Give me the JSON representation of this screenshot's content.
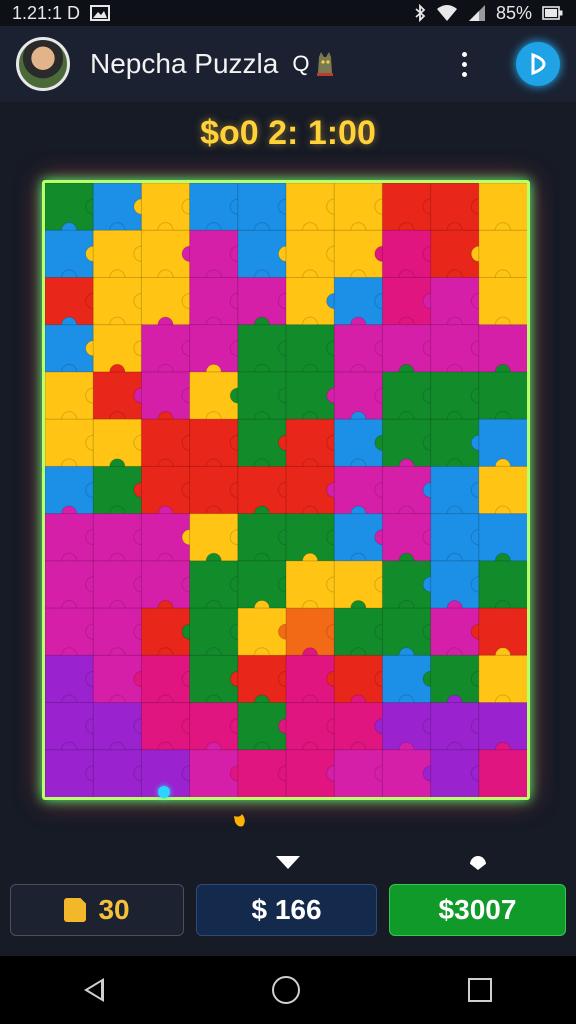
{
  "status_bar": {
    "time": "1.21:1 D",
    "battery": "85%",
    "icons": [
      "image-icon",
      "bluetooth-icon",
      "wifi-icon",
      "signal-icon",
      "battery-icon"
    ]
  },
  "app_bar": {
    "title": "Nepcha Puzzla",
    "title_glyph": "Q",
    "icons": [
      "avatar",
      "mascot-icon",
      "more-vert-icon",
      "brand-icon"
    ]
  },
  "timer": {
    "text": "$o0 2: 1:00"
  },
  "board": {
    "colors": {
      "Y": "#ffc414",
      "G": "#128c2b",
      "B": "#1c8fe6",
      "R": "#e82619",
      "M": "#d61fa9",
      "P": "#9a22cf",
      "K": "#e0157f",
      "O": "#f26a15"
    },
    "grid": [
      "GBYBBYYRRY",
      "BYYMBYYKRY",
      "RYYMMYBKMY",
      "BYMMGGMMMM",
      "YRMYGGMGGG",
      "YYRRGRBGGB",
      "BGRRRRMMBY",
      "MMMYGGBMBB",
      "MMMGGYYGBG",
      "MMRGYOGGMR",
      "PMKGRKRBGY",
      "PPKKGKKPPP",
      "PPPMKKMMPK"
    ]
  },
  "buttons": {
    "pieces_label": "30",
    "coins_label": "$ 166",
    "buy_label": "$3007"
  }
}
